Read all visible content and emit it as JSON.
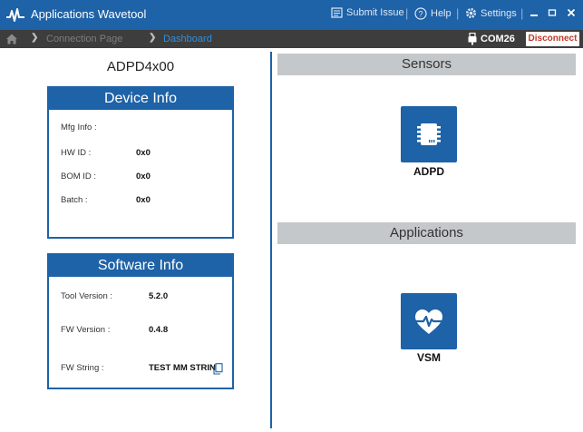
{
  "titlebar": {
    "title": "Applications Wavetool",
    "submit_issue": "Submit Issue",
    "help": "Help",
    "settings": "Settings"
  },
  "nav": {
    "crumb1": "Connection Page",
    "crumb2": "Dashboard",
    "port": "COM26",
    "disconnect": "Disconnect"
  },
  "device": {
    "name": "ADPD4x00",
    "device_info": {
      "header": "Device Info",
      "rows": [
        {
          "label": "Mfg Info :",
          "value": ""
        },
        {
          "label": "HW ID :",
          "value": "0x0"
        },
        {
          "label": "BOM ID :",
          "value": "0x0"
        },
        {
          "label": "Batch :",
          "value": "0x0"
        }
      ]
    },
    "software_info": {
      "header": "Software Info",
      "rows": [
        {
          "label": "Tool Version :",
          "value": "5.2.0"
        },
        {
          "label": "FW Version :",
          "value": "0.4.8"
        },
        {
          "label": "FW String :",
          "value": "TEST MM STRING"
        }
      ]
    }
  },
  "sensors": {
    "header": "Sensors",
    "tiles": [
      {
        "label": "ADPD",
        "icon": "chip-icon"
      }
    ]
  },
  "applications": {
    "header": "Applications",
    "tiles": [
      {
        "label": "VSM",
        "icon": "heart-pulse-icon"
      }
    ]
  },
  "colors": {
    "accent": "#1e62a7",
    "navbar": "#3d3d3d",
    "section_bar": "#c5c8ca",
    "disconnect_text": "#c0392b"
  }
}
